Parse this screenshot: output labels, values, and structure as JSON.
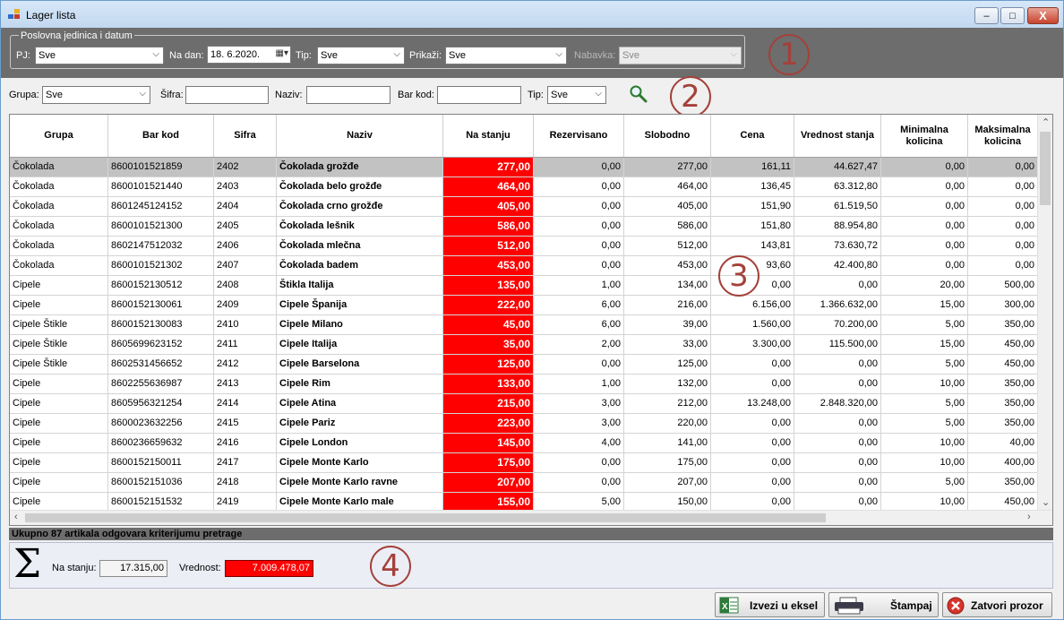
{
  "window": {
    "title": "Lager lista",
    "controls": {
      "minimize": "–",
      "maximize": "□",
      "close": "X"
    }
  },
  "filters": {
    "groupbox_title": "Poslovna jedinica i datum",
    "pj_label": "PJ:",
    "pj_value": "Sve",
    "na_dan_label": "Na dan:",
    "na_dan_value": "18.  6.2020.",
    "tip_label": "Tip:",
    "tip_value": "Sve",
    "prikazi_label": "Prikaži:",
    "prikazi_value": "Sve",
    "nabavka_label": "Nabavka:",
    "nabavka_value": "Sve"
  },
  "search": {
    "grupa_label": "Grupa:",
    "grupa_value": "Sve",
    "sifra_label": "Šifra:",
    "sifra_value": "",
    "naziv_label": "Naziv:",
    "naziv_value": "",
    "barkod_label": "Bar kod:",
    "barkod_value": "",
    "tip_label": "Tip:",
    "tip_value": "Sve"
  },
  "badges": [
    "1",
    "2",
    "3",
    "4"
  ],
  "grid": {
    "columns": [
      "Grupa",
      "Bar kod",
      "Sifra",
      "Naziv",
      "Na stanju",
      "Rezervisano",
      "Slobodno",
      "Cena",
      "Vrednost stanja",
      "Minimalna kolicina",
      "Maksimalna kolicina"
    ],
    "rows": [
      [
        "Čokolada",
        "8600101521859",
        "2402",
        "Čokolada grožđe",
        "277,00",
        "0,00",
        "277,00",
        "161,11",
        "44.627,47",
        "0,00",
        "0,00"
      ],
      [
        "Čokolada",
        "8600101521440",
        "2403",
        "Čokolada belo grožđe",
        "464,00",
        "0,00",
        "464,00",
        "136,45",
        "63.312,80",
        "0,00",
        "0,00"
      ],
      [
        "Čokolada",
        "8601245124152",
        "2404",
        "Čokolada crno grožđe",
        "405,00",
        "0,00",
        "405,00",
        "151,90",
        "61.519,50",
        "0,00",
        "0,00"
      ],
      [
        "Čokolada",
        "8600101521300",
        "2405",
        "Čokolada lešnik",
        "586,00",
        "0,00",
        "586,00",
        "151,80",
        "88.954,80",
        "0,00",
        "0,00"
      ],
      [
        "Čokolada",
        "8602147512032",
        "2406",
        "Čokolada mlečna",
        "512,00",
        "0,00",
        "512,00",
        "143,81",
        "73.630,72",
        "0,00",
        "0,00"
      ],
      [
        "Čokolada",
        "8600101521302",
        "2407",
        "Čokolada badem",
        "453,00",
        "0,00",
        "453,00",
        "93,60",
        "42.400,80",
        "0,00",
        "0,00"
      ],
      [
        "Cipele",
        "8600152130512",
        "2408",
        "Štikla Italija",
        "135,00",
        "1,00",
        "134,00",
        "0,00",
        "0,00",
        "20,00",
        "500,00"
      ],
      [
        "Cipele",
        "8600152130061",
        "2409",
        "Cipele Španija",
        "222,00",
        "6,00",
        "216,00",
        "6.156,00",
        "1.366.632,00",
        "15,00",
        "300,00"
      ],
      [
        "Cipele Štikle",
        "8600152130083",
        "2410",
        "Cipele Milano",
        "45,00",
        "6,00",
        "39,00",
        "1.560,00",
        "70.200,00",
        "5,00",
        "350,00"
      ],
      [
        "Cipele Štikle",
        "8605699623152",
        "2411",
        "Cipele Italija",
        "35,00",
        "2,00",
        "33,00",
        "3.300,00",
        "115.500,00",
        "15,00",
        "450,00"
      ],
      [
        "Cipele Štikle",
        "8602531456652",
        "2412",
        "Cipele Barselona",
        "125,00",
        "0,00",
        "125,00",
        "0,00",
        "0,00",
        "5,00",
        "450,00"
      ],
      [
        "Cipele",
        "8602255636987",
        "2413",
        "Cipele Rim",
        "133,00",
        "1,00",
        "132,00",
        "0,00",
        "0,00",
        "10,00",
        "350,00"
      ],
      [
        "Cipele",
        "8605956321254",
        "2414",
        "Cipele Atina",
        "215,00",
        "3,00",
        "212,00",
        "13.248,00",
        "2.848.320,00",
        "5,00",
        "350,00"
      ],
      [
        "Cipele",
        "8600023632256",
        "2415",
        "Cipele Pariz",
        "223,00",
        "3,00",
        "220,00",
        "0,00",
        "0,00",
        "5,00",
        "350,00"
      ],
      [
        "Cipele",
        "8600236659632",
        "2416",
        "Cipele London",
        "145,00",
        "4,00",
        "141,00",
        "0,00",
        "0,00",
        "10,00",
        "40,00"
      ],
      [
        "Cipele",
        "8600152150011",
        "2417",
        "Cipele Monte Karlo",
        "175,00",
        "0,00",
        "175,00",
        "0,00",
        "0,00",
        "10,00",
        "400,00"
      ],
      [
        "Cipele",
        "8600152151036",
        "2418",
        "Cipele Monte Karlo ravne",
        "207,00",
        "0,00",
        "207,00",
        "0,00",
        "0,00",
        "5,00",
        "350,00"
      ],
      [
        "Cipele",
        "8600152151532",
        "2419",
        "Cipele Monte Karlo male",
        "155,00",
        "5,00",
        "150,00",
        "0,00",
        "0,00",
        "10,00",
        "450,00"
      ]
    ]
  },
  "status": {
    "text": "Ukupno 87 artikala odgovara kriterijumu pretrage"
  },
  "summary": {
    "na_stanju_label": "Na stanju:",
    "na_stanju_value": "17.315,00",
    "vrednost_label": "Vrednost:",
    "vrednost_value": "7.009.478,07"
  },
  "buttons": {
    "export_label": "Izvezi u eksel",
    "print_label": "Štampaj",
    "close_label": "Zatvori prozor"
  },
  "icons": {
    "app": "app-icon",
    "search": "magnifier-icon",
    "sum": "sigma-icon",
    "export": "excel-icon",
    "print": "printer-icon",
    "close": "close-circle-icon"
  },
  "colors": {
    "stock_cell": "#ff0000",
    "filter_band": "#6d6d6d",
    "selected_row": "#c2c2c2"
  }
}
